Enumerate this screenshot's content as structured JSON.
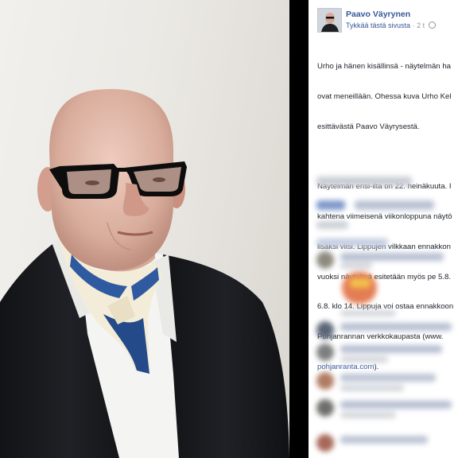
{
  "post": {
    "author": "Paavo Väyrynen",
    "like_page_link": "Tykkää tästä sivusta",
    "separator": "·",
    "time": "2 t",
    "lines": [
      "Urho ja hänen kisällinsä - näytelmän ha",
      "ovat meneillään. Ohessa kuva Urho Kel",
      "esittävästä Paavo Väyrysestä.",
      "",
      "Näytelmän ensi-ilta on 22. heinäkuuta. I",
      "kahtena viimeisenä viikonloppuna näytö",
      "lisäksi viisi. Lippujen vilkkaan ennakkon",
      "vuoksi näytelmä esitetään myös pe 5.8.",
      "6.8. klo 14. Lippuja voi ostaa ennakkoon",
      "Pohjanrannan verkkokaupasta (www."
    ],
    "link_text": "pohjanranta.com",
    "link_suffix": ")."
  },
  "colors": {
    "link_blue": "#365899",
    "text": "#1d2129",
    "meta_gray": "#90949c"
  },
  "icons": {
    "globe": "globe-icon",
    "avatar": "profile-avatar"
  }
}
